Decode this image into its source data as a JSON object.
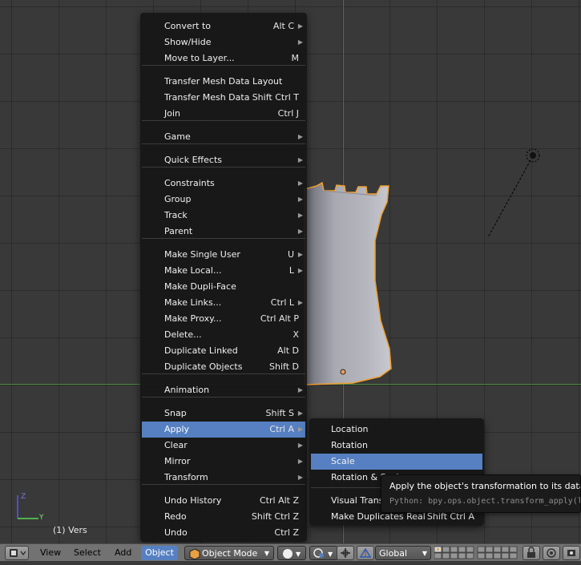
{
  "viewport": {
    "info_text": "(1) Vers"
  },
  "object_menu": {
    "items": [
      {
        "label": "Convert to",
        "shortcut": "Alt C",
        "submenu": true
      },
      {
        "label": "Show/Hide",
        "shortcut": "",
        "submenu": true
      },
      {
        "label": "Move to Layer...",
        "shortcut": "M",
        "submenu": false
      },
      {
        "label": "Transfer Mesh Data Layout",
        "shortcut": "",
        "submenu": false
      },
      {
        "label": "Transfer Mesh Data",
        "shortcut": "Shift Ctrl T",
        "submenu": false
      },
      {
        "label": "Join",
        "shortcut": "Ctrl J",
        "submenu": false
      },
      {
        "label": "Game",
        "shortcut": "",
        "submenu": true
      },
      {
        "label": "Quick Effects",
        "shortcut": "",
        "submenu": true
      },
      {
        "label": "Constraints",
        "shortcut": "",
        "submenu": true
      },
      {
        "label": "Group",
        "shortcut": "",
        "submenu": true
      },
      {
        "label": "Track",
        "shortcut": "",
        "submenu": true
      },
      {
        "label": "Parent",
        "shortcut": "",
        "submenu": true
      },
      {
        "label": "Make Single User",
        "shortcut": "U",
        "submenu": true
      },
      {
        "label": "Make Local...",
        "shortcut": "L",
        "submenu": true
      },
      {
        "label": "Make Dupli-Face",
        "shortcut": "",
        "submenu": false
      },
      {
        "label": "Make Links...",
        "shortcut": "Ctrl L",
        "submenu": true
      },
      {
        "label": "Make Proxy...",
        "shortcut": "Ctrl Alt P",
        "submenu": false
      },
      {
        "label": "Delete...",
        "shortcut": "X",
        "submenu": false
      },
      {
        "label": "Duplicate Linked",
        "shortcut": "Alt D",
        "submenu": false
      },
      {
        "label": "Duplicate Objects",
        "shortcut": "Shift D",
        "submenu": false
      },
      {
        "label": "Animation",
        "shortcut": "",
        "submenu": true
      },
      {
        "label": "Snap",
        "shortcut": "Shift S",
        "submenu": true
      },
      {
        "label": "Apply",
        "shortcut": "Ctrl A",
        "submenu": true,
        "active": true
      },
      {
        "label": "Clear",
        "shortcut": "",
        "submenu": true
      },
      {
        "label": "Mirror",
        "shortcut": "",
        "submenu": true
      },
      {
        "label": "Transform",
        "shortcut": "",
        "submenu": true
      },
      {
        "label": "Undo History",
        "shortcut": "Ctrl Alt Z",
        "submenu": false
      },
      {
        "label": "Redo",
        "shortcut": "Shift Ctrl Z",
        "submenu": false
      },
      {
        "label": "Undo",
        "shortcut": "Ctrl Z",
        "submenu": false
      }
    ]
  },
  "apply_submenu": {
    "items": [
      {
        "label": "Location",
        "shortcut": ""
      },
      {
        "label": "Rotation",
        "shortcut": ""
      },
      {
        "label": "Scale",
        "shortcut": "",
        "active": true
      },
      {
        "label": "Rotation & Scale",
        "shortcut": ""
      },
      {
        "label": "Visual Transform",
        "shortcut": ""
      },
      {
        "label": "Make Duplicates Real",
        "shortcut": "Shift Ctrl A"
      }
    ]
  },
  "tooltip": {
    "description": "Apply the object's transformation to its data",
    "python": "Python: bpy.ops.object.transform_apply(l"
  },
  "header": {
    "menus": [
      "View",
      "Select",
      "Add",
      "Object"
    ],
    "active_menu": "Object",
    "mode": "Object Mode",
    "orientation": "Global"
  },
  "colors": {
    "accent": "#5680c2",
    "selection_outline": "#f0a030",
    "menu_bg": "#161616",
    "header_bg": "#727272"
  },
  "icons": [
    "editor-type-icon",
    "object-mode-icon",
    "viewport-shading-icon",
    "pivot-point-icon",
    "manipulator-icon",
    "transform-orientation-icon",
    "layer-buttons",
    "lock-icon",
    "proportional-edit-icon",
    "render-icon",
    "camera-light-icon"
  ]
}
